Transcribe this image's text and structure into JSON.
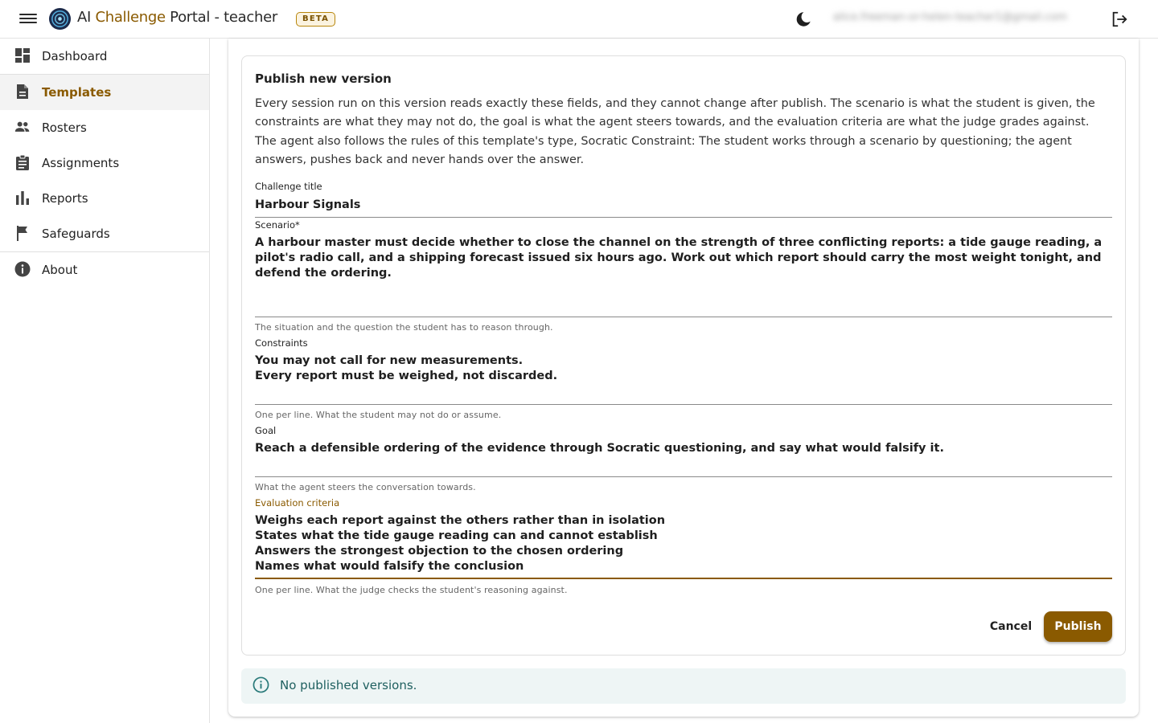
{
  "header": {
    "title_prefix": "AI ",
    "title_accent": "Challenge",
    "title_suffix": " Portal - teacher",
    "beta_badge": "BETA",
    "user_email": "alice.freeman-or-helen-teacher1@gmail.com",
    "icons": {
      "menu": "menu-icon",
      "logo": "portal-logo",
      "theme": "dark-mode-moon-icon",
      "logout": "logout-icon"
    }
  },
  "sidebar": {
    "items": [
      {
        "label": "Dashboard",
        "icon": "dashboard-icon",
        "active": false
      },
      {
        "label": "Templates",
        "icon": "description-icon",
        "active": true
      },
      {
        "label": "Rosters",
        "icon": "people-icon",
        "active": false
      },
      {
        "label": "Assignments",
        "icon": "assignment-icon",
        "active": false
      },
      {
        "label": "Reports",
        "icon": "bar-chart-icon",
        "active": false
      },
      {
        "label": "Safeguards",
        "icon": "flag-icon",
        "active": false
      },
      {
        "label": "About",
        "icon": "info-icon",
        "active": false
      }
    ]
  },
  "form": {
    "title": "Publish new version",
    "description": "Every session run on this version reads exactly these fields, and they cannot change after publish. The scenario is what the student is given, the constraints are what they may not do, the goal is what the agent steers towards, and the evaluation criteria are what the judge grades against. The agent also follows the rules of this template's type, Socratic Constraint: The student works through a scenario by questioning; the agent answers, pushes back and never hands over the answer.",
    "fields": {
      "title": {
        "label": "Challenge title",
        "value": "Harbour Signals"
      },
      "scenario": {
        "label": "Scenario*",
        "value": "A harbour master must decide whether to close the channel on the strength of three conflicting reports: a tide gauge reading, a pilot's radio call, and a shipping forecast issued six hours ago. Work out which report should carry the most weight tonight, and defend the ordering.",
        "help": "The situation and the question the student has to reason through."
      },
      "constraints": {
        "label": "Constraints",
        "value": "You may not call for new measurements.\nEvery report must be weighed, not discarded.",
        "help": "One per line. What the student may not do or assume."
      },
      "goal": {
        "label": "Goal",
        "value": "Reach a defensible ordering of the evidence through Socratic questioning, and say what would falsify it.",
        "help": "What the agent steers the conversation towards."
      },
      "criteria": {
        "label": "Evaluation criteria",
        "value": "Weighs each report against the others rather than in isolation\nStates what the tide gauge reading can and cannot establish\nAnswers the strongest objection to the chosen ordering\nNames what would falsify the conclusion",
        "help": "One per line. What the judge checks the student's reasoning against."
      }
    },
    "cancel_label": "Cancel",
    "publish_label": "Publish"
  },
  "alert": {
    "text": "No published versions.",
    "icon": "info-outline-icon"
  },
  "colors": {
    "accent": "#8a5a00",
    "alert_bg": "#eef5f5",
    "alert_text": "#1e5f5f"
  }
}
